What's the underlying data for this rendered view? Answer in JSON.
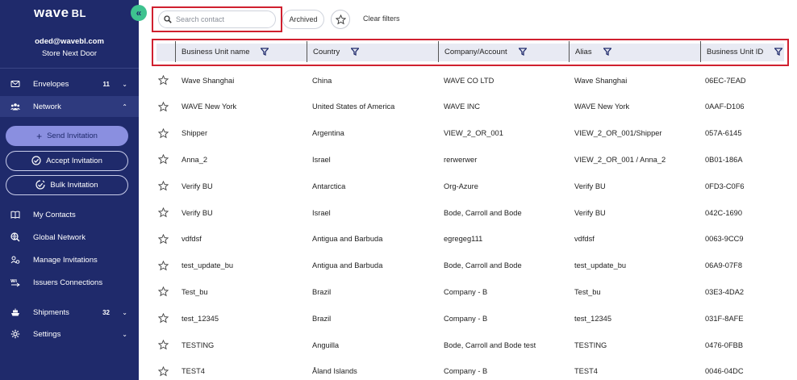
{
  "sidebar": {
    "logo": "wave",
    "logo_suffix": "BL",
    "collapse_glyph": "«",
    "user_email": "oded@wavebl.com",
    "user_store": "Store Next Door",
    "nav": {
      "envelopes": {
        "label": "Envelopes",
        "count": "11",
        "icon": "envelope-icon"
      },
      "network": {
        "label": "Network",
        "icon": "network-icon"
      },
      "shipments": {
        "label": "Shipments",
        "count": "32",
        "icon": "ship-icon"
      },
      "settings": {
        "label": "Settings",
        "icon": "gear-icon"
      }
    },
    "actions": {
      "send": "Send Invitation",
      "accept": "Accept Invitation",
      "bulk": "Bulk Invitation"
    },
    "sub_items": {
      "my_contacts": "My Contacts",
      "global_network": "Global Network",
      "manage_invitations": "Manage Invitations",
      "issuers_connections": "Issuers Connections"
    }
  },
  "toolbar": {
    "search_placeholder": "Search contact",
    "archived_label": "Archived",
    "clear_filters_label": "Clear filters"
  },
  "table": {
    "columns": [
      "Business Unit name",
      "Country",
      "Company/Account",
      "Alias",
      "Business Unit ID"
    ],
    "rows": [
      {
        "name": "Wave Shanghai",
        "country": "China",
        "company": "WAVE CO LTD",
        "alias": "Wave Shanghai",
        "id": "06EC-7EAD"
      },
      {
        "name": "WAVE New York",
        "country": "United States of America",
        "company": "WAVE INC",
        "alias": "WAVE New York",
        "id": "0AAF-D106"
      },
      {
        "name": "Shipper",
        "country": "Argentina",
        "company": "VIEW_2_OR_001",
        "alias": "VIEW_2_OR_001/Shipper",
        "id": "057A-6145"
      },
      {
        "name": "Anna_2",
        "country": "Israel",
        "company": "rerwerwer",
        "alias": "VIEW_2_OR_001 / Anna_2",
        "id": "0B01-186A"
      },
      {
        "name": "Verify BU",
        "country": "Antarctica",
        "company": "Org-Azure",
        "alias": "Verify BU",
        "id": "0FD3-C0F6"
      },
      {
        "name": "Verify BU",
        "country": "Israel",
        "company": "Bode, Carroll and Bode",
        "alias": "Verify BU",
        "id": "042C-1690"
      },
      {
        "name": "vdfdsf",
        "country": "Antigua and Barbuda",
        "company": "egregeg111",
        "alias": "vdfdsf",
        "id": "0063-9CC9"
      },
      {
        "name": "test_update_bu",
        "country": "Antigua and Barbuda",
        "company": "Bode, Carroll and Bode",
        "alias": "test_update_bu",
        "id": "06A9-07F8"
      },
      {
        "name": "Test_bu",
        "country": "Brazil",
        "company": "Company - B",
        "alias": "Test_bu",
        "id": "03E3-4DA2"
      },
      {
        "name": "test_12345",
        "country": "Brazil",
        "company": "Company - B",
        "alias": "test_12345",
        "id": "031F-8AFE"
      },
      {
        "name": "TESTING",
        "country": "Anguilla",
        "company": "Bode, Carroll and Bode test",
        "alias": "TESTING",
        "id": "0476-0FBB"
      },
      {
        "name": "TEST4",
        "country": "Åland Islands",
        "company": "Company - B",
        "alias": "TEST4",
        "id": "0046-04DC"
      }
    ]
  },
  "colors": {
    "sidebar_bg": "#1f2a6b",
    "accent_green": "#3ec28f",
    "primary_pill": "#8a8fe0",
    "highlight_red": "#d0202f"
  }
}
